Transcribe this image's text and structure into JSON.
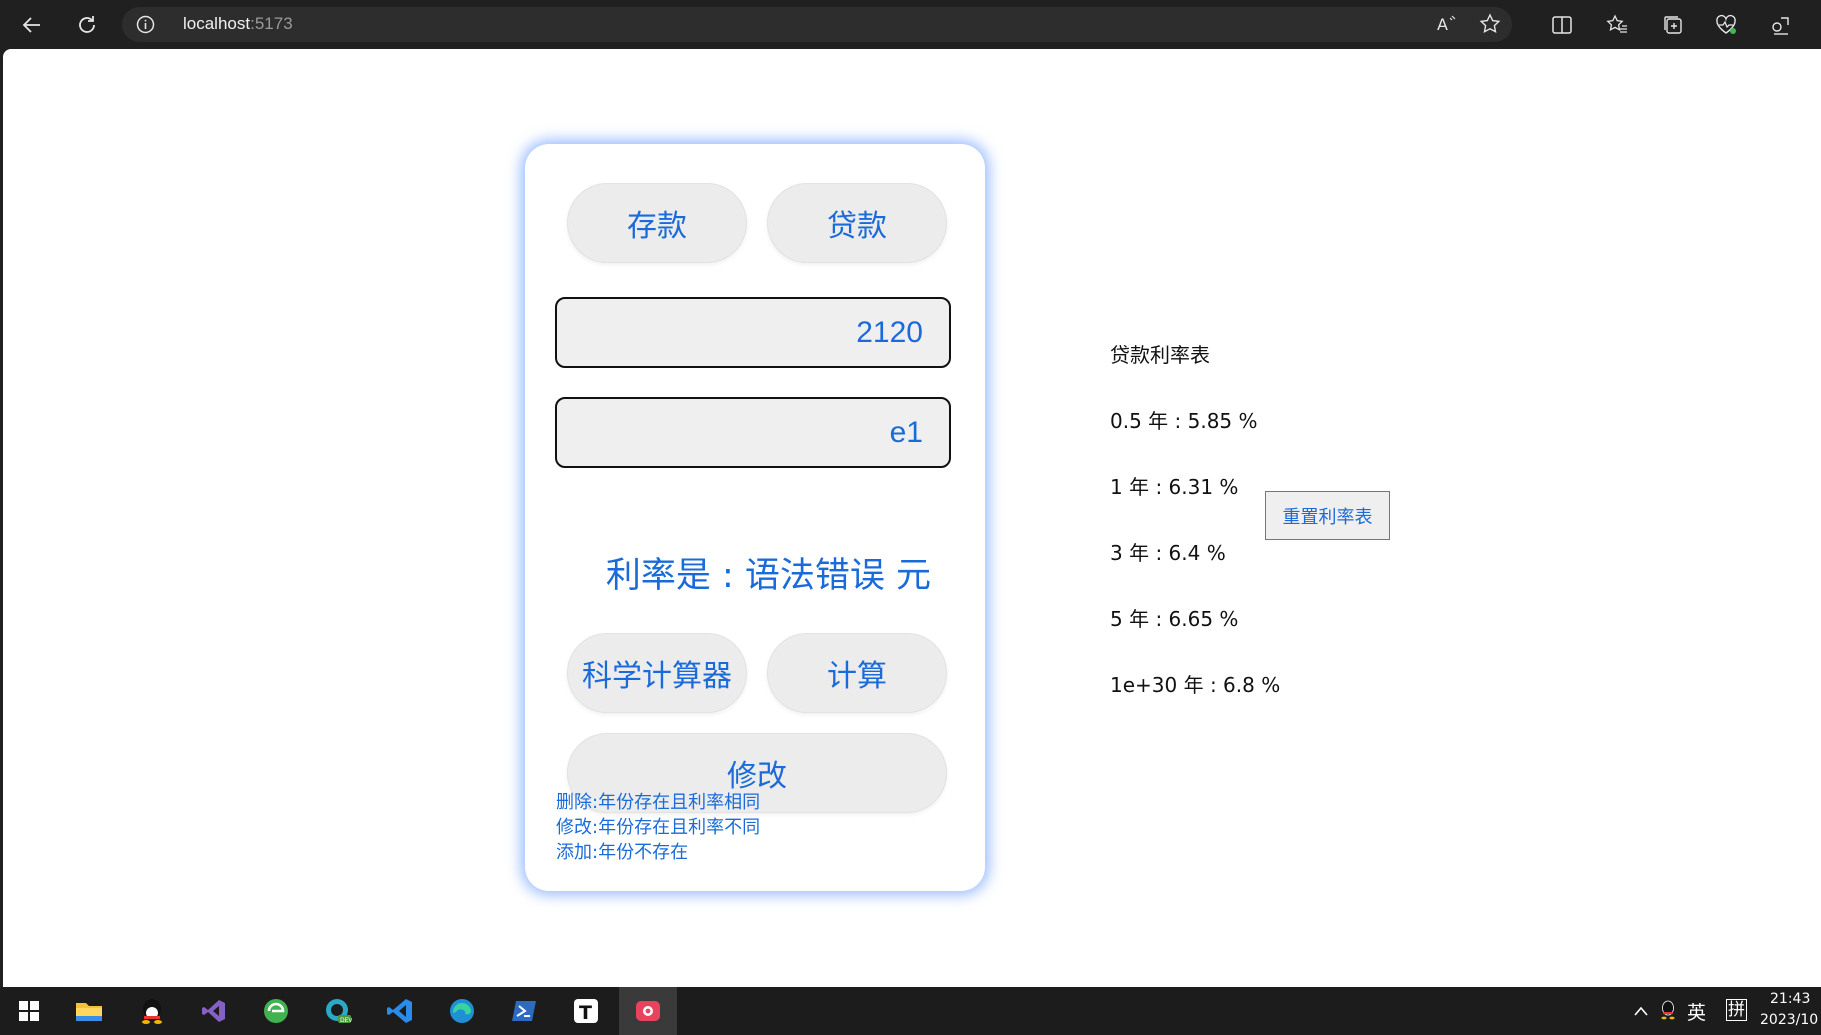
{
  "browser": {
    "address_host": "localhost",
    "address_port": ":5173"
  },
  "calculator": {
    "tab_deposit": "存款",
    "tab_loan": "贷款",
    "input_amount_value": "2120",
    "input_years_value": "e1",
    "result_text": "利率是 : 语法错误 元",
    "btn_scientific": "科学计算器",
    "btn_calculate": "计算",
    "btn_modify": "修改",
    "notes": [
      "删除:年份存在且利率相同",
      "修改:年份存在且利率不同",
      "添加:年份不存在"
    ]
  },
  "rate_table": {
    "title": "贷款利率表",
    "rows": [
      "0.5 年 : 5.85 %",
      "1 年 : 6.31 %",
      "3 年 : 6.4 %",
      "5 年 : 6.65 %",
      "1e+30 年 : 6.8 %"
    ],
    "reset_button": "重置利率表"
  },
  "taskbar": {
    "apps": [
      "start-icon",
      "file-explorer-icon",
      "qq-icon",
      "visual-studio-icon",
      "360-browser-icon",
      "edge-dev-icon",
      "vscode-icon",
      "edge-icon",
      "powershell-icon",
      "typora-icon",
      "screen-recorder-icon"
    ],
    "ime_lang": "英",
    "ime_mode": "拼",
    "time": "21:43",
    "date": "2023/10"
  },
  "colors": {
    "accent": "#1a6bd9",
    "card_glow": "#78a5ff",
    "taskbar": "#1c1c1c",
    "chrome": "#202020"
  }
}
